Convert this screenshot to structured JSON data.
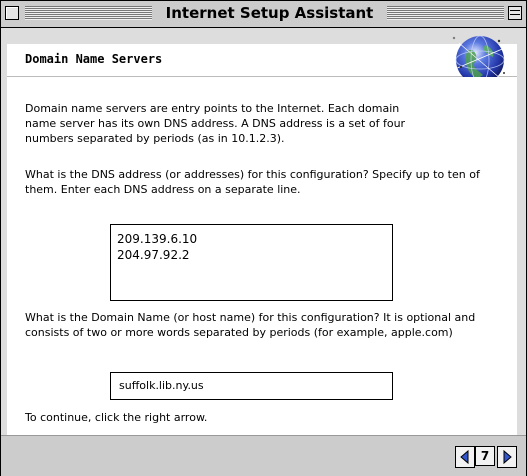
{
  "window": {
    "title": "Internet Setup Assistant"
  },
  "header": {
    "title": "Domain Name Servers",
    "logo_icon": "globe-icon"
  },
  "main": {
    "intro_text": "Domain name servers are entry points to the Internet.  Each domain name server has its own DNS address. A DNS address is a set of four numbers separated by periods (as in 10.1.2.3).",
    "dns_question": "What is the DNS address (or addresses) for this configuration?  Specify up to ten of them.  Enter each DNS address on a separate line.",
    "dns_addresses": [
      "209.139.6.10",
      "204.97.92.2"
    ],
    "domain_question": "What is the Domain Name (or host name) for this configuration?  It is optional and consists of two or more words separated by periods (for example, apple.com)",
    "domain_value": "suffolk.lib.ny.us",
    "continue_text": "To continue, click the right arrow."
  },
  "footer": {
    "page_number": "7",
    "prev_icon": "left-arrow-icon",
    "next_icon": "right-arrow-icon"
  },
  "colors": {
    "window_bg": "#dddddd",
    "accent_blue": "#3355cc"
  }
}
